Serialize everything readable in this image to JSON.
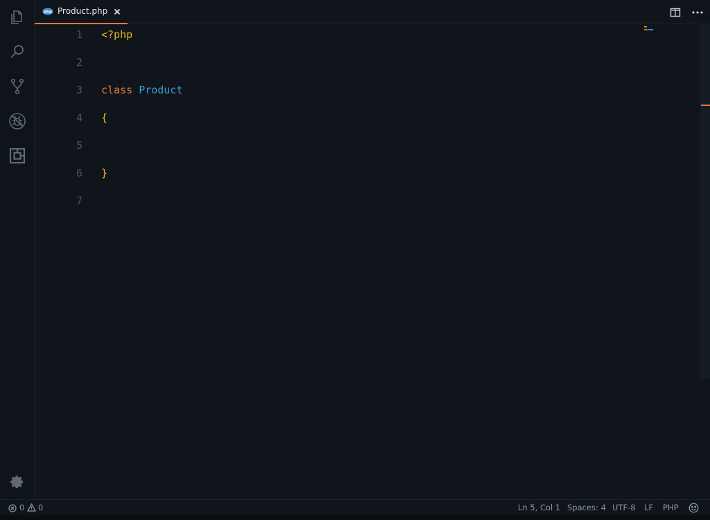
{
  "tab": {
    "filename": "Product.php",
    "icon": "php-file-icon",
    "close_symbol": "×"
  },
  "editor": {
    "lines": [
      {
        "number": "1",
        "tokens": [
          {
            "text": "<?php",
            "kind": "tag"
          }
        ]
      },
      {
        "number": "2",
        "tokens": []
      },
      {
        "number": "3",
        "tokens": [
          {
            "text": "class",
            "kind": "kw"
          },
          {
            "text": " ",
            "kind": "plain"
          },
          {
            "text": "Product",
            "kind": "cls"
          }
        ]
      },
      {
        "number": "4",
        "tokens": [
          {
            "text": "{",
            "kind": "brace"
          }
        ]
      },
      {
        "number": "5",
        "tokens": []
      },
      {
        "number": "6",
        "tokens": [
          {
            "text": "}",
            "kind": "brace"
          }
        ]
      },
      {
        "number": "7",
        "tokens": []
      }
    ]
  },
  "statusbar": {
    "errors": "0",
    "warnings": "0",
    "cursor": "Ln 5, Col 1",
    "indent": "Spaces: 4",
    "encoding": "UTF-8",
    "eol": "LF",
    "language": "PHP"
  },
  "colors": {
    "background": "#10151b",
    "accent": "#e57a3c",
    "keyword": "#e57a3c",
    "class_name": "#3d9bd6",
    "php_tag": "#e6b422",
    "line_number": "#4a5561"
  },
  "activity_icons": [
    "explorer-icon",
    "search-icon",
    "source-control-icon",
    "debug-icon",
    "extensions-icon",
    "gear-icon"
  ]
}
